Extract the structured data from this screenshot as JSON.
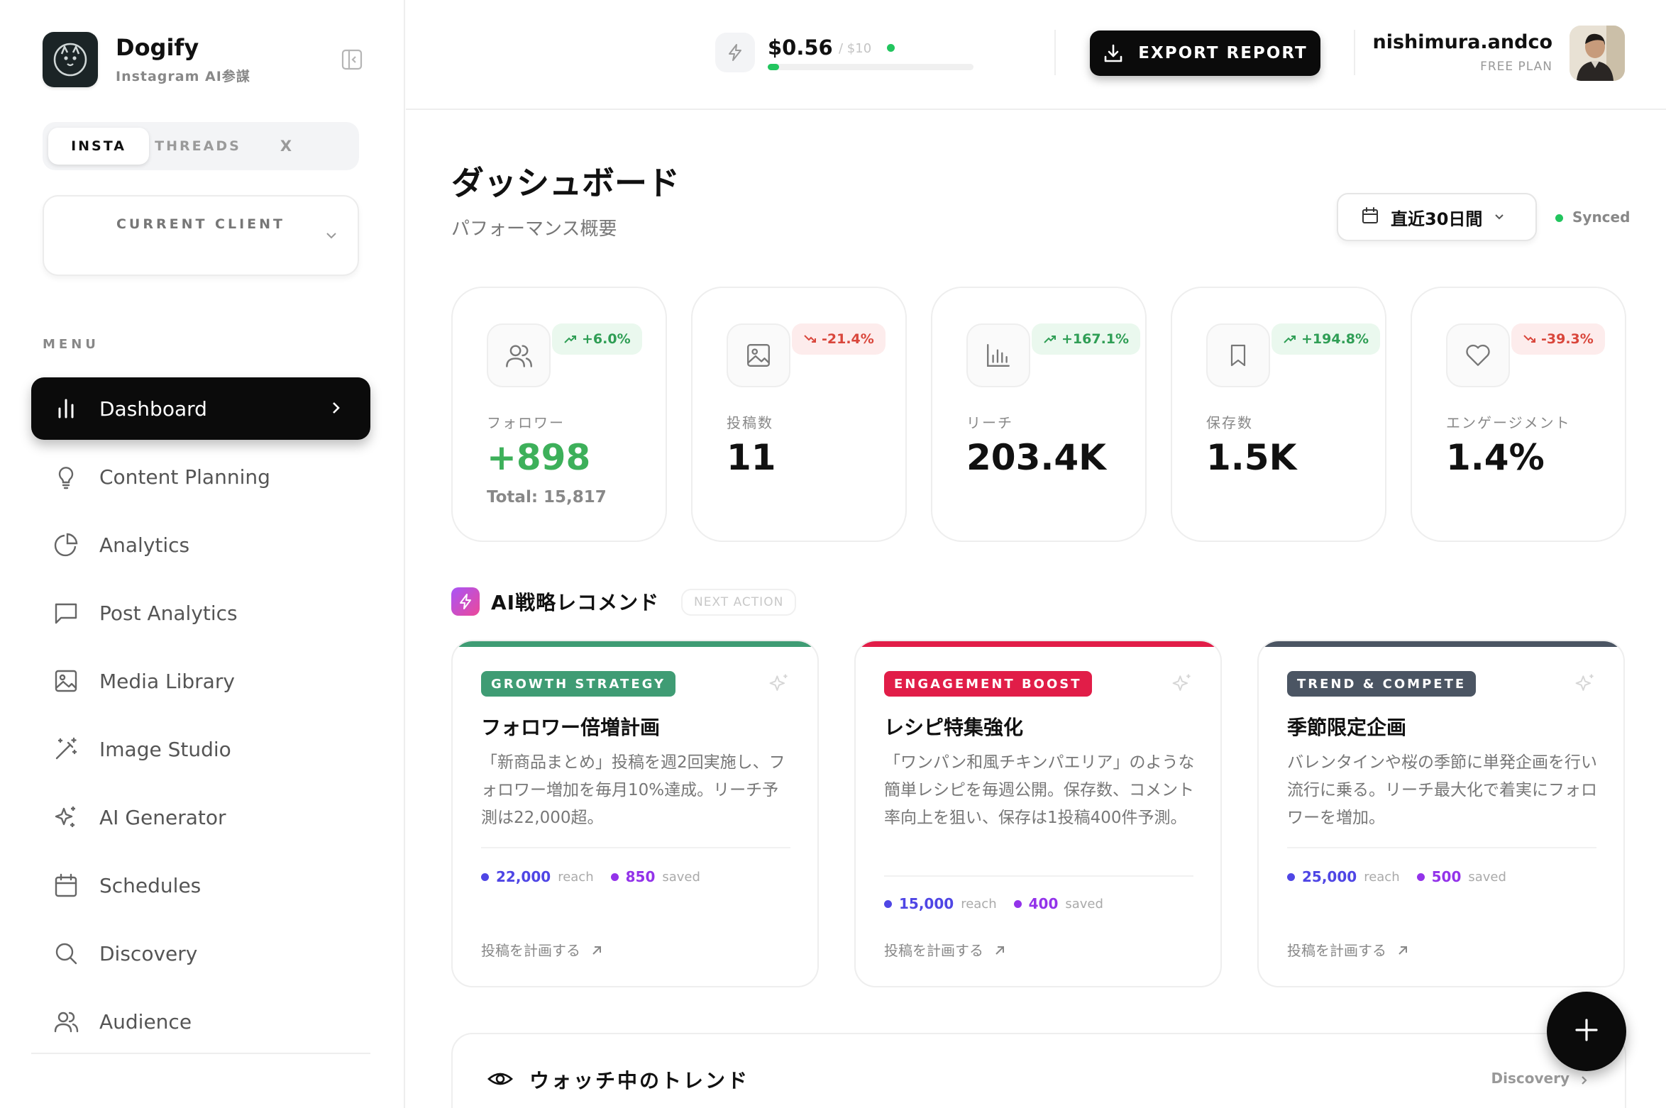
{
  "brand": {
    "name": "Dogify",
    "subtitle": "Instagram AI参謀"
  },
  "platform_tabs": [
    {
      "label": "INSTA",
      "active": true
    },
    {
      "label": "THREADS",
      "active": false
    },
    {
      "label": "X",
      "active": false
    }
  ],
  "client_selector": {
    "label": "CURRENT CLIENT",
    "value": ""
  },
  "menu": {
    "label": "MENU",
    "items": [
      {
        "label": "Dashboard",
        "icon": "bar-chart-icon",
        "active": true
      },
      {
        "label": "Content Planning",
        "icon": "lightbulb-icon"
      },
      {
        "label": "Analytics",
        "icon": "pie-chart-icon"
      },
      {
        "label": "Post Analytics",
        "icon": "message-square-icon"
      },
      {
        "label": "Media Library",
        "icon": "image-icon"
      },
      {
        "label": "Image Studio",
        "icon": "magic-wand-icon"
      },
      {
        "label": "AI Generator",
        "icon": "sparkles-icon"
      },
      {
        "label": "Schedules",
        "icon": "calendar-icon"
      },
      {
        "label": "Discovery",
        "icon": "search-icon"
      },
      {
        "label": "Audience",
        "icon": "users-icon"
      }
    ]
  },
  "header": {
    "credit": {
      "amount": "$0.56",
      "limit": "/ $10",
      "used_fraction": 0.056
    },
    "export_label": "EXPORT REPORT",
    "user": {
      "name": "nishimura.andco",
      "plan": "FREE PLAN"
    }
  },
  "page": {
    "title": "ダッシュボード",
    "subtitle": "パフォーマンス概要",
    "range_label": "直近30日間",
    "sync_status": "Synced"
  },
  "stats": [
    {
      "label": "フォロワー",
      "value": "+898",
      "change": "+6.0%",
      "direction": "up",
      "total": "Total: 15,817",
      "icon": "users-icon"
    },
    {
      "label": "投稿数",
      "value": "11",
      "change": "-21.4%",
      "direction": "down",
      "icon": "image-icon"
    },
    {
      "label": "リーチ",
      "value": "203.4K",
      "change": "+167.1%",
      "direction": "up",
      "icon": "bar-chart-icon"
    },
    {
      "label": "保存数",
      "value": "1.5K",
      "change": "+194.8%",
      "direction": "up",
      "icon": "bookmark-icon"
    },
    {
      "label": "エンゲージメント",
      "value": "1.4%",
      "change": "-39.3%",
      "direction": "down",
      "icon": "heart-icon"
    }
  ],
  "ai_section": {
    "title": "AI戦略レコメンド",
    "tag": "NEXT ACTION"
  },
  "recommendations": [
    {
      "tag": "GROWTH STRATEGY",
      "title": "フォロワー倍増計画",
      "body": "「新商品まとめ」投稿を週2回実施し、フォロワー増加を毎月10%達成。リーチ予測は22,000超。",
      "reach": "22,000",
      "reach_unit": "reach",
      "saved": "850",
      "saved_unit": "saved",
      "link": "投稿を計画する",
      "accent": "#3f9c74"
    },
    {
      "tag": "ENGAGEMENT BOOST",
      "title": "レシピ特集強化",
      "body": "「ワンパン和風チキンパエリア」のような簡単レシピを毎週公開。保存数、コメント率向上を狙い、保存は1投稿400件予測。",
      "reach": "15,000",
      "reach_unit": "reach",
      "saved": "400",
      "saved_unit": "saved",
      "link": "投稿を計画する",
      "accent": "#e11d48"
    },
    {
      "tag": "TREND & COMPETE",
      "title": "季節限定企画",
      "body": "バレンタインや桜の季節に単発企画を行い流行に乗る。リーチ最大化で着実にフォロワーを増加。",
      "reach": "25,000",
      "reach_unit": "reach",
      "saved": "500",
      "saved_unit": "saved",
      "link": "投稿を計画する",
      "accent": "#4b5563"
    }
  ],
  "trends": {
    "title": "ウォッチ中のトレンド",
    "link": "Discovery"
  },
  "colors": {
    "accent_dark": "#0b0b0b",
    "up": "#2f9e55",
    "down": "#d9463b",
    "reach_dot": "#4f46e5",
    "saved_dot": "#9333ea"
  }
}
